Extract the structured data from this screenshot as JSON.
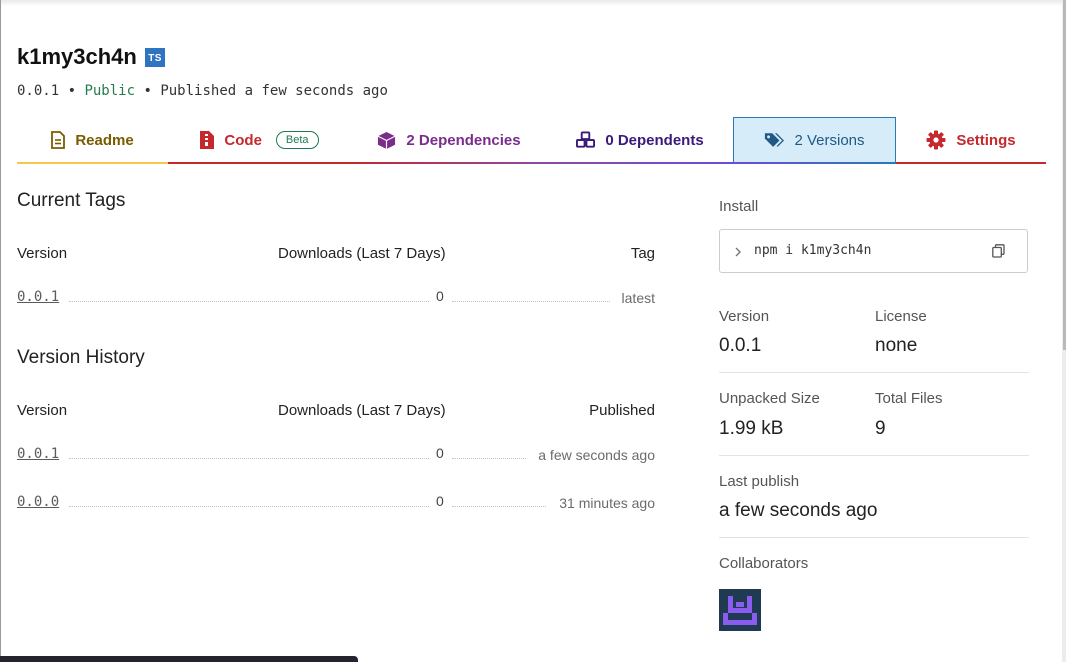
{
  "package": {
    "name": "k1my3ch4n",
    "ts_badge": "TS",
    "version": "0.0.1",
    "sep1": " • ",
    "visibility": "Public",
    "sep2": " • Published ",
    "published": "a few seconds ago"
  },
  "tabs": [
    {
      "label": "Readme",
      "color": "#7a5c00",
      "underline": "#f2c94c",
      "icon": "readme-file-icon"
    },
    {
      "label": "Code",
      "color": "#c5282d",
      "underline": "#c5282d",
      "badge": "Beta",
      "icon": "code-file-icon"
    },
    {
      "label": "2 Dependencies",
      "color": "#7a2d8a",
      "underline": "#8b4aa8",
      "icon": "box-icon"
    },
    {
      "label": "0 Dependents",
      "color": "#3a1a7a",
      "underline": "#6b4bd8",
      "icon": "boxes-icon"
    },
    {
      "label": "2 Versions",
      "color": "#1f5a86",
      "underline": "#2a7ab8",
      "active": true,
      "icon": "tags-icon"
    },
    {
      "label": "Settings",
      "color": "#c5282d",
      "underline": "#c5282d",
      "icon": "gear-icon"
    }
  ],
  "current_tags": {
    "title": "Current Tags",
    "headers": [
      "Version",
      "Downloads (Last 7 Days)",
      "Tag"
    ],
    "rows": [
      {
        "version": "0.0.1",
        "downloads": "0",
        "tag": "latest"
      }
    ]
  },
  "version_history": {
    "title": "Version History",
    "headers": [
      "Version",
      "Downloads (Last 7 Days)",
      "Published"
    ],
    "rows": [
      {
        "version": "0.0.1",
        "downloads": "0",
        "published": "a few seconds ago"
      },
      {
        "version": "0.0.0",
        "downloads": "0",
        "published": "31 minutes ago"
      }
    ]
  },
  "sidebar": {
    "install_label": "Install",
    "install_command": "npm i k1my3ch4n",
    "version_label": "Version",
    "version_value": "0.0.1",
    "license_label": "License",
    "license_value": "none",
    "unpacked_label": "Unpacked Size",
    "unpacked_value": "1.99 kB",
    "files_label": "Total Files",
    "files_value": "9",
    "last_publish_label": "Last publish",
    "last_publish_value": "a few seconds ago",
    "collaborators_label": "Collaborators"
  },
  "colors": {
    "public": "#287a4c",
    "active_tab_bg": "#d6ecf8",
    "active_tab_border": "#2a7ab8",
    "avatar_bg": "#1f3a52",
    "avatar_fg": "#8a5cf0"
  }
}
